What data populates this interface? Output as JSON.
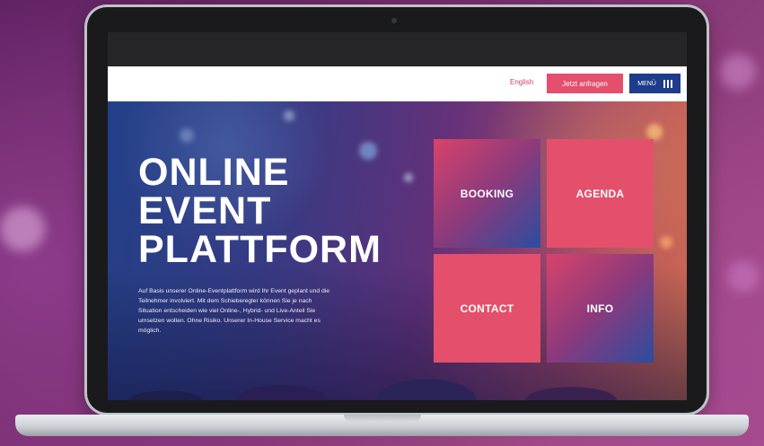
{
  "header": {
    "language_link": "English",
    "cta_button": "Jetzt anfragen",
    "menu_button": "MENÜ"
  },
  "hero": {
    "title_lines": [
      "ONLINE",
      "EVENT",
      "PLATTFORM"
    ],
    "description": "Auf Basis unserer Online-Eventplattform wird Ihr Event geplant und die Teilnehmer involviert. Mit dem Schieberegler können Sie je nach Situation entscheiden wie viel Online-, Hybrid- und Live-Anteil Sie umsetzen wollen. Ohne Risiko. Unserer In-House Service macht es möglich."
  },
  "tiles": {
    "booking": "BOOKING",
    "agenda": "AGENDA",
    "contact": "CONTACT",
    "info": "INFO"
  },
  "colors": {
    "accent_pink": "#e4506b",
    "menu_blue": "#1d3c8c",
    "link_pink": "#d93a63"
  },
  "icons": {
    "menu": "hamburger-bars-icon"
  }
}
